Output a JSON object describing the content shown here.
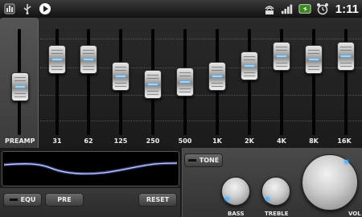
{
  "statusbar": {
    "left_icons": [
      "equalizer-app-icon",
      "usb-icon",
      "play-icon"
    ],
    "right_icons": [
      "wifi-icon",
      "signal-icon",
      "battery-icon",
      "alarm-icon"
    ],
    "time": "1:11"
  },
  "eq": {
    "preamp_label": "PREAMP",
    "bands": [
      {
        "label": "31"
      },
      {
        "label": "62"
      },
      {
        "label": "125"
      },
      {
        "label": "250"
      },
      {
        "label": "500"
      },
      {
        "label": "1K"
      },
      {
        "label": "2K"
      },
      {
        "label": "4K"
      },
      {
        "label": "8K"
      },
      {
        "label": "16K"
      }
    ]
  },
  "controls": {
    "equ_label": "EQU",
    "pre_label": "PRE",
    "reset_label": "RESET",
    "tone_label": "TONE",
    "bass_label": "BASS",
    "treble_label": "TREBLE",
    "vol_label": "VOL"
  },
  "colors": {
    "accent": "#5ab8ff",
    "curve": "#8fa8ff"
  }
}
